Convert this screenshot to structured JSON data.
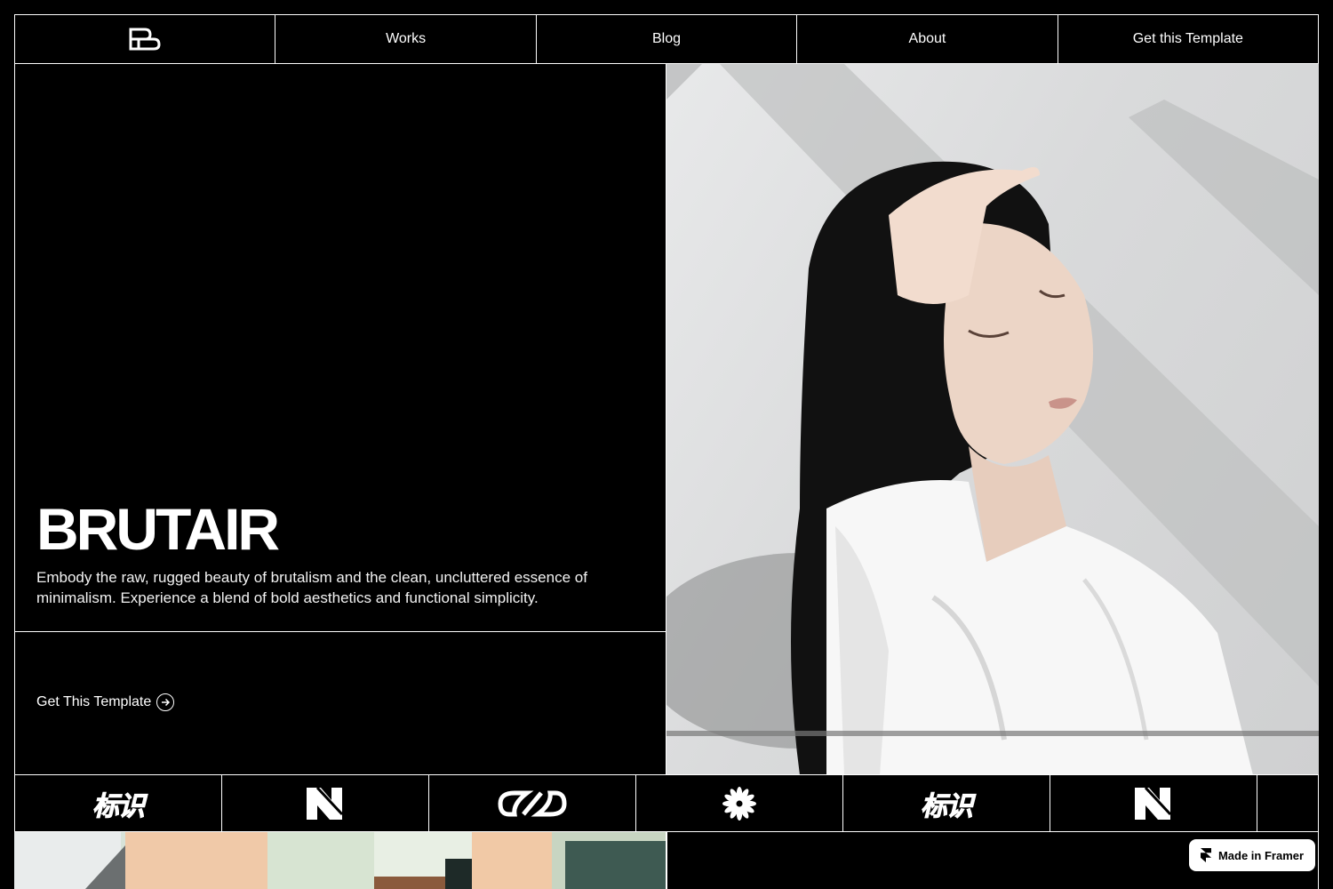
{
  "nav": {
    "logo_icon": "brutair-b-logo-icon",
    "items": [
      {
        "label": "Works"
      },
      {
        "label": "Blog"
      },
      {
        "label": "About"
      },
      {
        "label": "Get this Template"
      }
    ]
  },
  "hero": {
    "title": "BRUTAIR",
    "description": "Embody the raw, rugged beauty of brutalism and the clean, uncluttered essence of minimalism. Experience a blend of bold aesthetics and functional simplicity.",
    "cta_label": "Get This Template",
    "cta_icon": "arrow-right-circle-icon",
    "image": "woman-in-white-shirt-photo"
  },
  "logos": {
    "items": [
      {
        "kind": "text",
        "text": "标识"
      },
      {
        "kind": "icon",
        "icon": "n-mark-logo-icon"
      },
      {
        "kind": "icon",
        "icon": "infinity-link-logo-icon"
      },
      {
        "kind": "icon",
        "icon": "starburst-logo-icon"
      },
      {
        "kind": "text",
        "text": "标识"
      },
      {
        "kind": "icon",
        "icon": "n-mark-logo-icon"
      }
    ]
  },
  "bottom": {
    "image": "building-facade-photo"
  },
  "badge": {
    "label": "Made in Framer",
    "icon": "framer-icon"
  },
  "colors": {
    "background": "#000000",
    "foreground": "#ffffff",
    "badge_bg": "#ffffff"
  }
}
